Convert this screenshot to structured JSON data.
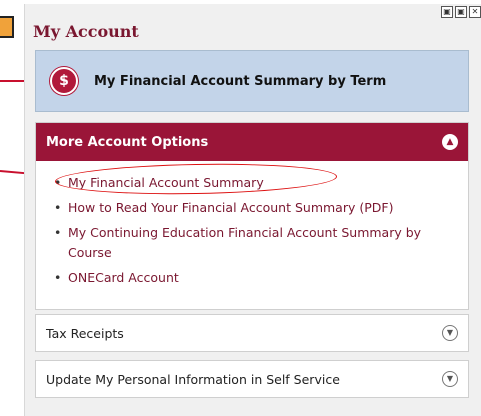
{
  "page": {
    "title": "My Account"
  },
  "window_controls": [
    "▣",
    "▣",
    "✕"
  ],
  "summary_card": {
    "icon": "dollar-icon",
    "symbol": "$",
    "label": "My Financial Account Summary by Term"
  },
  "more_options": {
    "title": "More Account Options",
    "collapse_glyph": "▲",
    "items": [
      {
        "label": "My Financial Account Summary"
      },
      {
        "label": "How to Read Your Financial Account Summary (PDF)"
      },
      {
        "label": "My Continuing Education Financial Account Summary by Course"
      },
      {
        "label": "ONECard Account"
      }
    ]
  },
  "accordion": [
    {
      "label": "Tax Receipts",
      "expand_glyph": "▼"
    },
    {
      "label": "Update My Personal Information in Self Service",
      "expand_glyph": "▼"
    }
  ],
  "colors": {
    "brand": "#9a1538",
    "link": "#7a1730",
    "card_bg": "#c3d4e9",
    "annotation": "#c8102e",
    "tab": "#f0a23a"
  }
}
